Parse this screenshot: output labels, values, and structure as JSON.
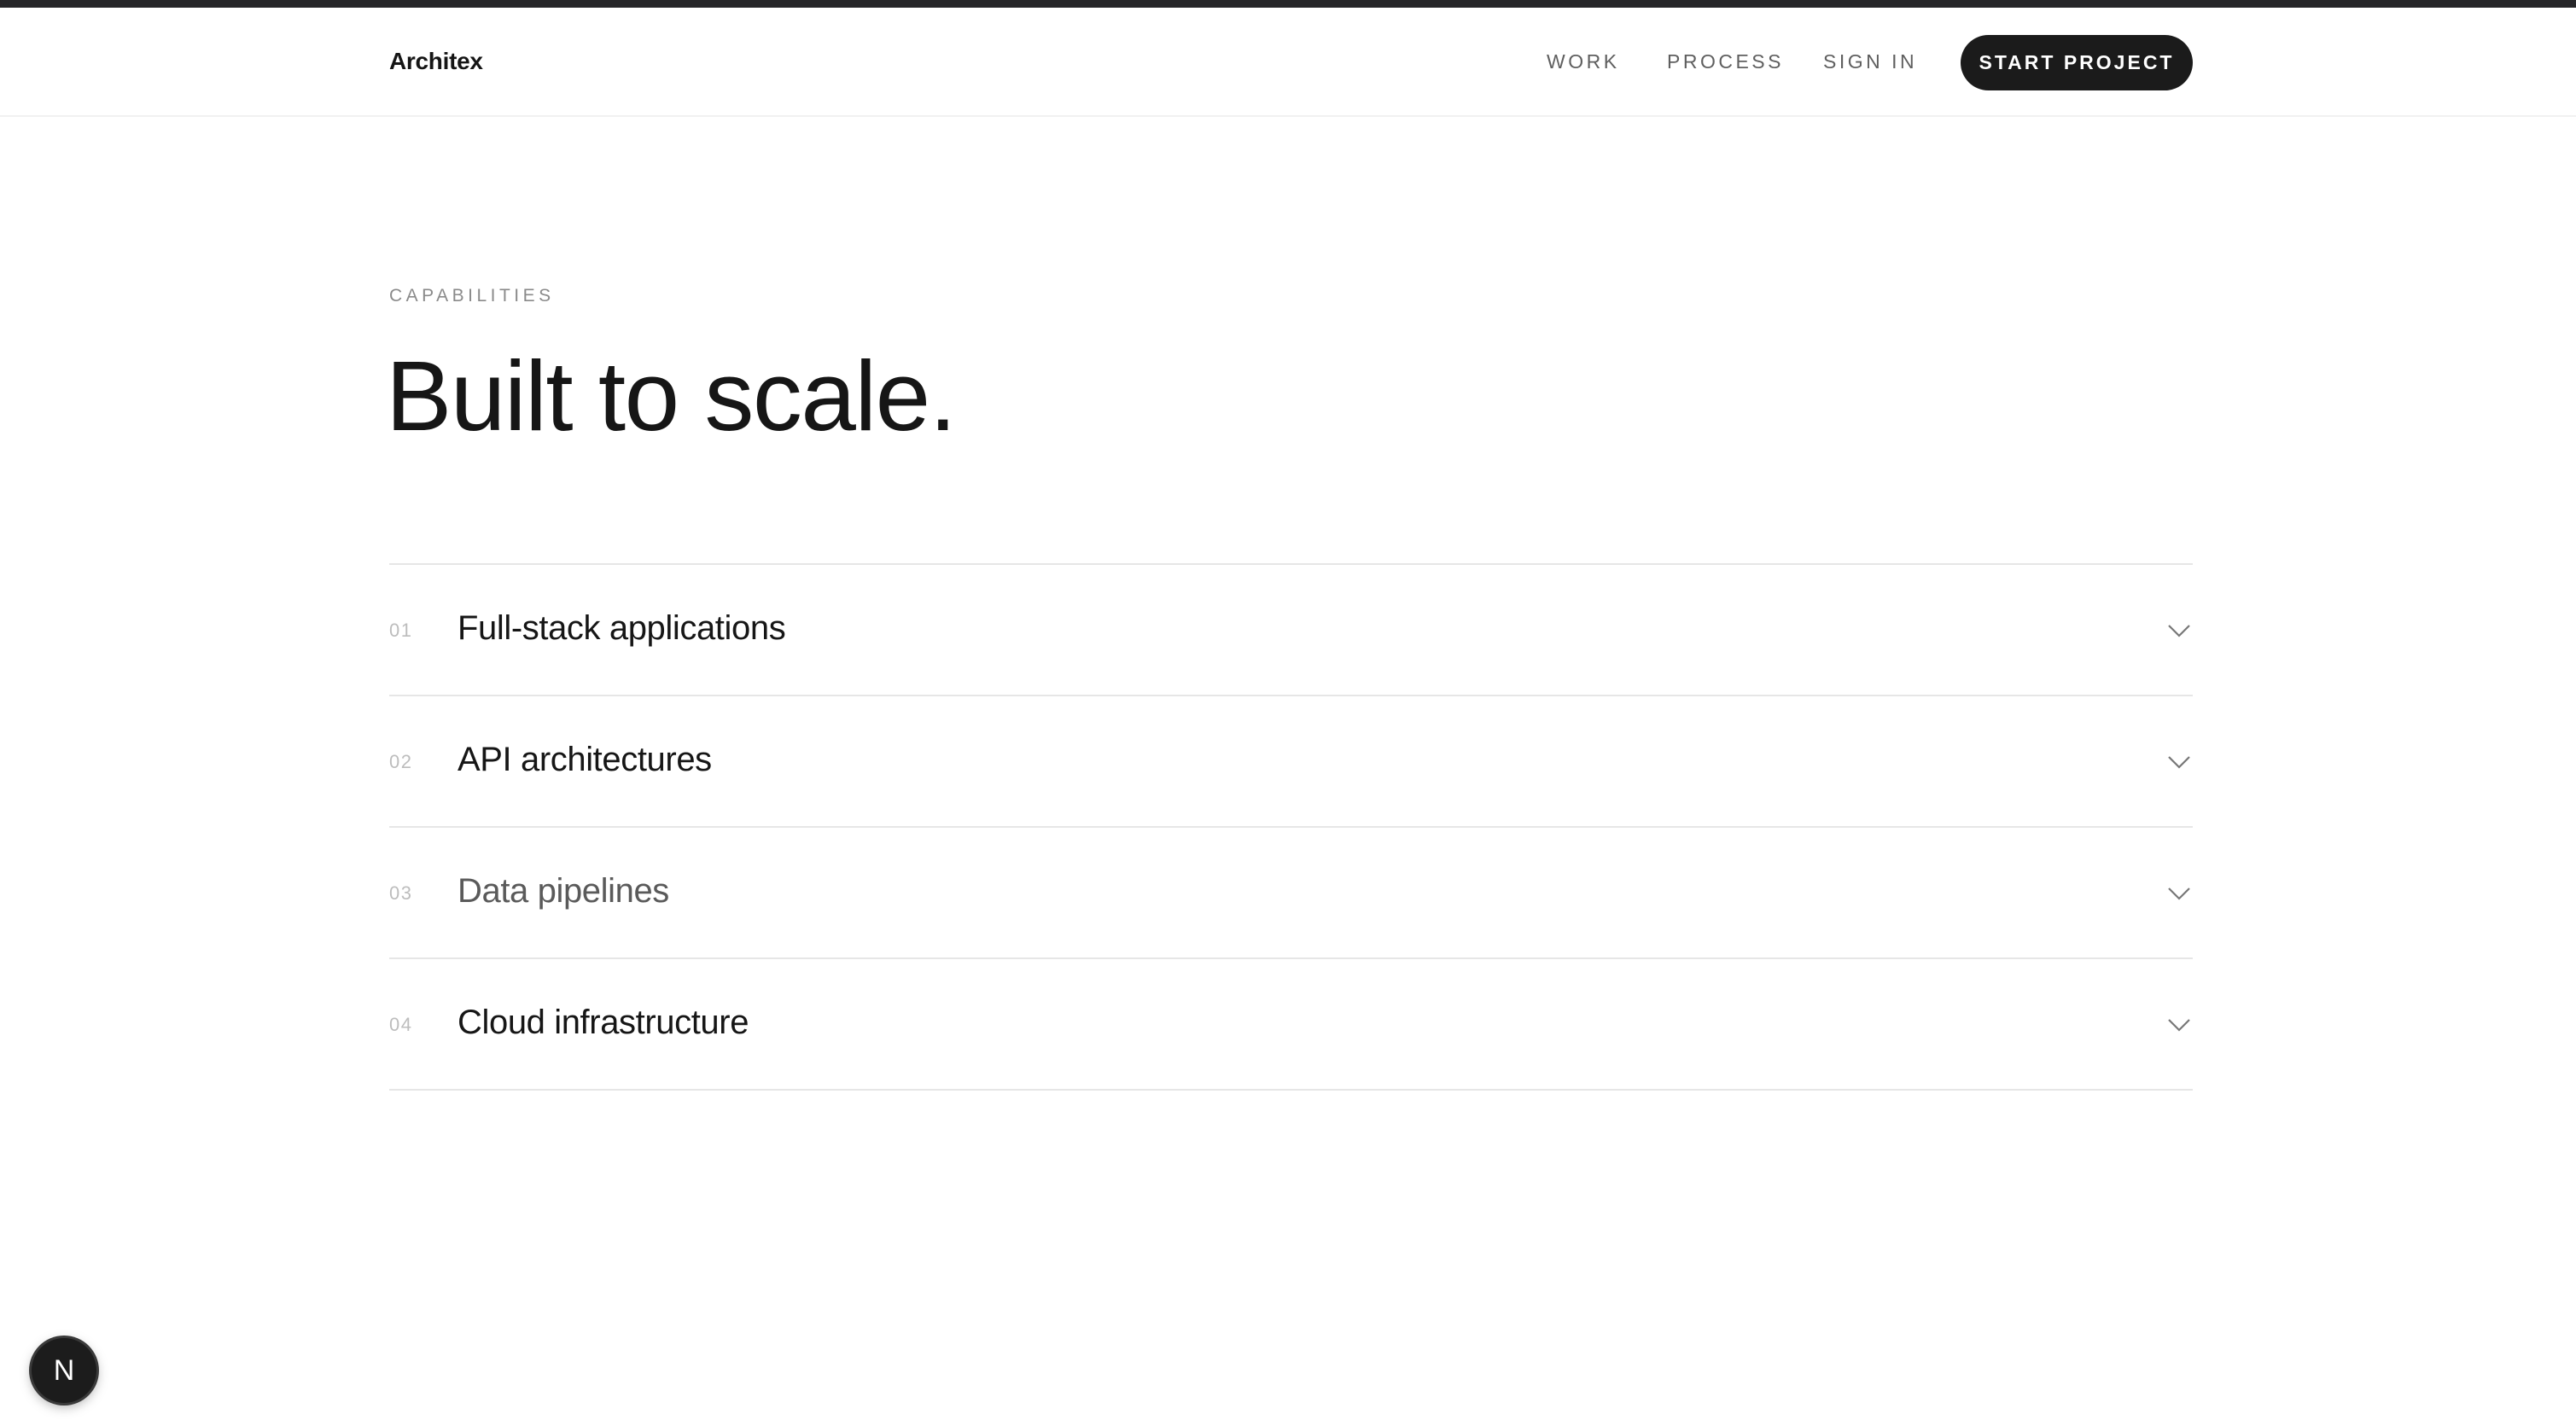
{
  "header": {
    "brand": "Architex",
    "nav": [
      {
        "label": "WORK"
      },
      {
        "label": "PROCESS"
      },
      {
        "label": "SIGN IN"
      }
    ],
    "cta_label": "START PROJECT"
  },
  "hero": {
    "eyebrow": "CAPABILITIES",
    "title": "Built to scale."
  },
  "capabilities": [
    {
      "number": "01",
      "title": "Full-stack applications",
      "icon": "chevron-down-icon"
    },
    {
      "number": "02",
      "title": "API architectures",
      "icon": "chevron-down-icon"
    },
    {
      "number": "03",
      "title": "Data pipelines",
      "icon": "chevron-down-icon"
    },
    {
      "number": "04",
      "title": "Cloud infrastructure",
      "icon": "chevron-down-icon"
    }
  ],
  "fab": {
    "glyph": "N",
    "icon": "nextjs-logo-icon"
  },
  "colors": {
    "accent_dark": "#1b1b1b",
    "muted_text": "#8a8a8a",
    "divider": "#e6e6e6"
  }
}
